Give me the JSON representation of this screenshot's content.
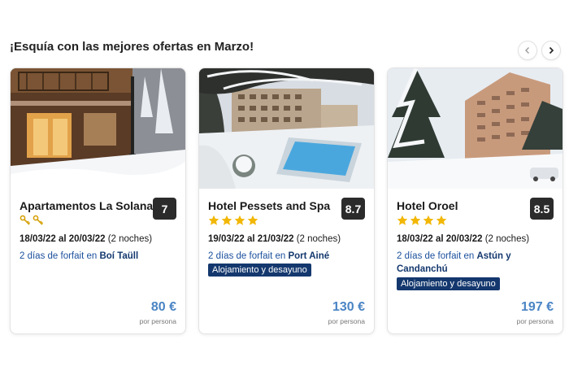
{
  "section": {
    "title": "¡Esquía con las mejores ofertas en Marzo!"
  },
  "nav": {
    "prev_icon": "chevron-left-icon",
    "next_icon": "chevron-right-icon"
  },
  "colors": {
    "score_bg": "#2b2b2b",
    "link_blue": "#1a4f9c",
    "badge_bg": "#14386e",
    "price_blue": "#4a84c4",
    "star_gold": "#f2b705"
  },
  "cards": [
    {
      "name": "Apartamentos La Solana",
      "score": "7",
      "rating_icon": "key-icon",
      "rating_count": 2,
      "dates": "18/03/22 al 20/03/22",
      "nights": "(2 noches)",
      "forfait_prefix": "2 días de forfait en",
      "forfait_resort": "Boí Taüll",
      "badge": "",
      "price": "80 €",
      "per": "por persona"
    },
    {
      "name": "Hotel Pessets and Spa",
      "score": "8.7",
      "rating_icon": "star-icon",
      "rating_count": 4,
      "dates": "19/03/22 al 21/03/22",
      "nights": "(2 noches)",
      "forfait_prefix": "2 días de forfait en",
      "forfait_resort": "Port Ainé",
      "badge": "Alojamiento y desayuno",
      "price": "130 €",
      "per": "por persona"
    },
    {
      "name": "Hotel Oroel",
      "score": "8.5",
      "rating_icon": "star-icon",
      "rating_count": 4,
      "dates": "18/03/22 al 20/03/22",
      "nights": "(2 noches)",
      "forfait_prefix": "2 días de forfait en",
      "forfait_resort": "Astún y Candanchú",
      "badge": "Alojamiento y desayuno",
      "price": "197 €",
      "per": "por persona"
    }
  ]
}
